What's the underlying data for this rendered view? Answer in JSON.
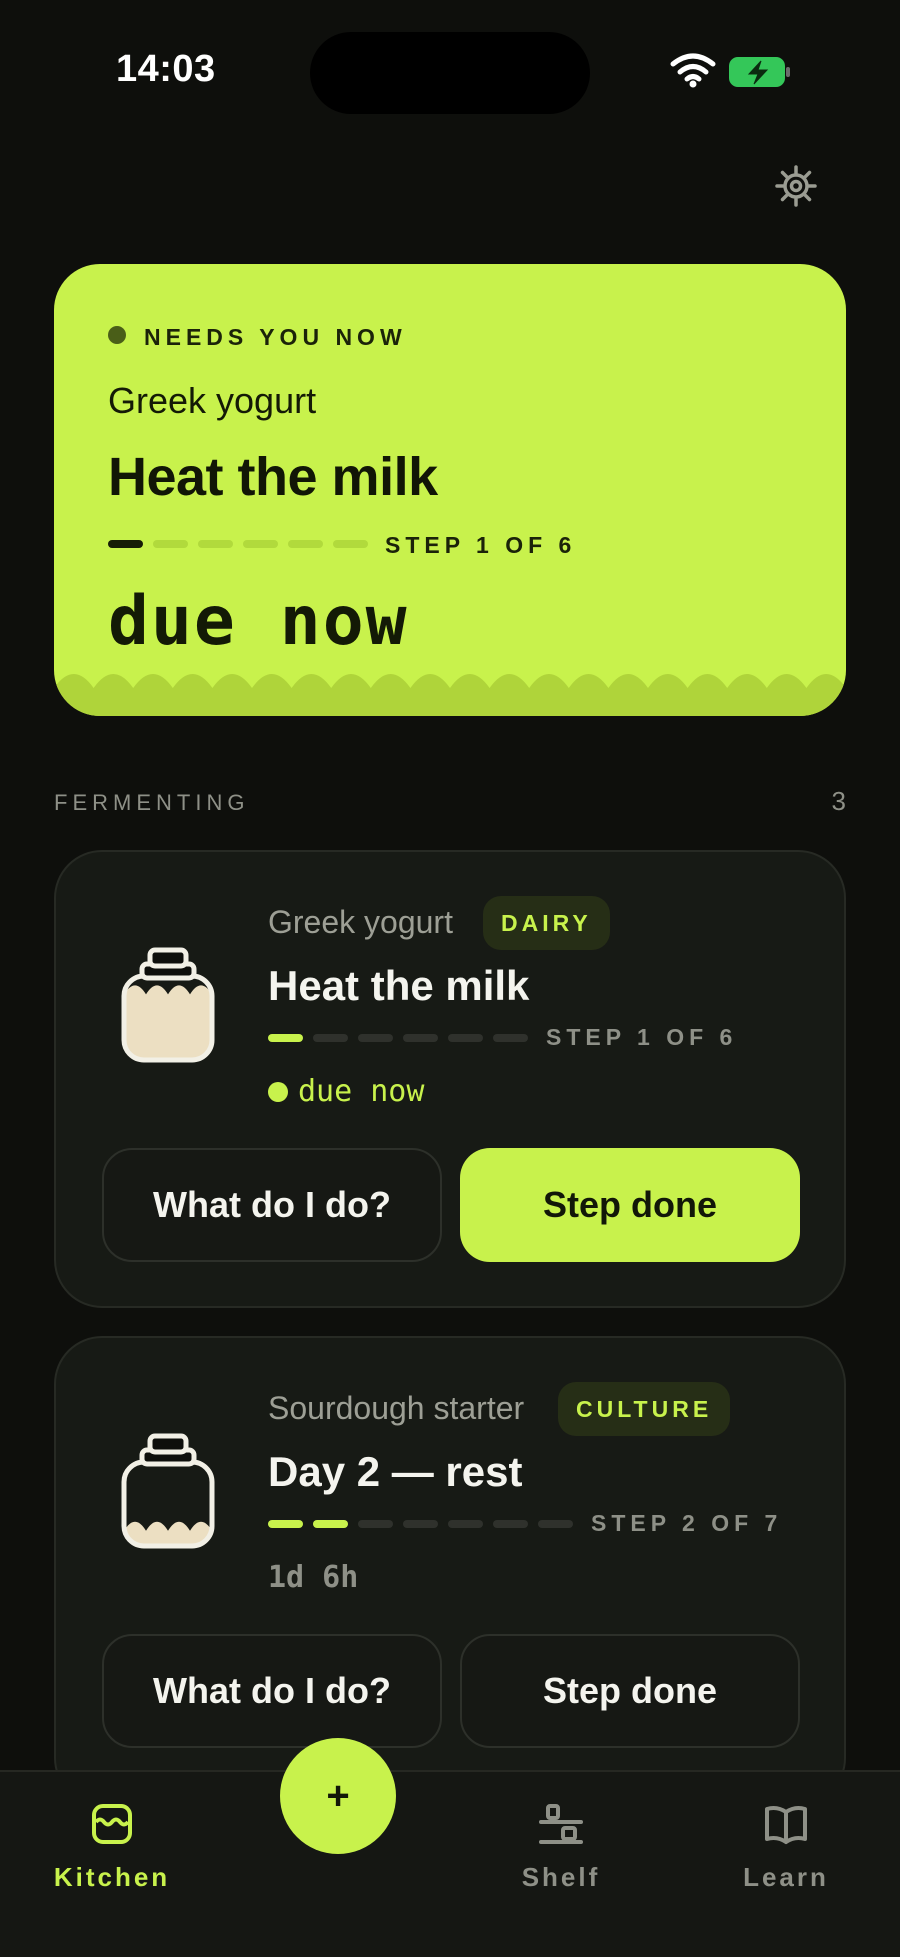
{
  "status_bar": {
    "time": "14:03"
  },
  "hero": {
    "kicker": "NEEDS YOU NOW",
    "item": "Greek yogurt",
    "title": "Heat the milk",
    "step_label": "STEP 1 OF 6",
    "step_current": 1,
    "step_total": 6,
    "due": "due  now"
  },
  "section": {
    "label": "FERMENTING",
    "count": "3"
  },
  "cards": [
    {
      "name": "Greek yogurt",
      "badge": "DAIRY",
      "title": "Heat the milk",
      "step_label": "STEP 1 OF 6",
      "step_current": 1,
      "step_total": 6,
      "due": "due  now",
      "jar_fill": 0.9,
      "help_label": "What do I do?",
      "done_label": "Step done"
    },
    {
      "name": "Sourdough starter",
      "badge": "CULTURE",
      "title": "Day 2 — rest",
      "step_label": "STEP 2 OF 7",
      "step_current": 2,
      "step_total": 7,
      "time_left": "1d  6h",
      "jar_fill": 0.3,
      "help_label": "What do I do?",
      "done_label": "Step done"
    }
  ],
  "fab": {
    "label": "+"
  },
  "tabs": [
    {
      "label": "Kitchen",
      "icon": "kitchen-icon",
      "active": true
    },
    {
      "label": "Shelf",
      "icon": "shelf-icon",
      "active": false
    },
    {
      "label": "Learn",
      "icon": "book-icon",
      "active": false
    }
  ],
  "colors": {
    "accent": "#c8f24c",
    "background": "#0e0f0c",
    "card": "#171a15",
    "muted": "#8e9087"
  }
}
